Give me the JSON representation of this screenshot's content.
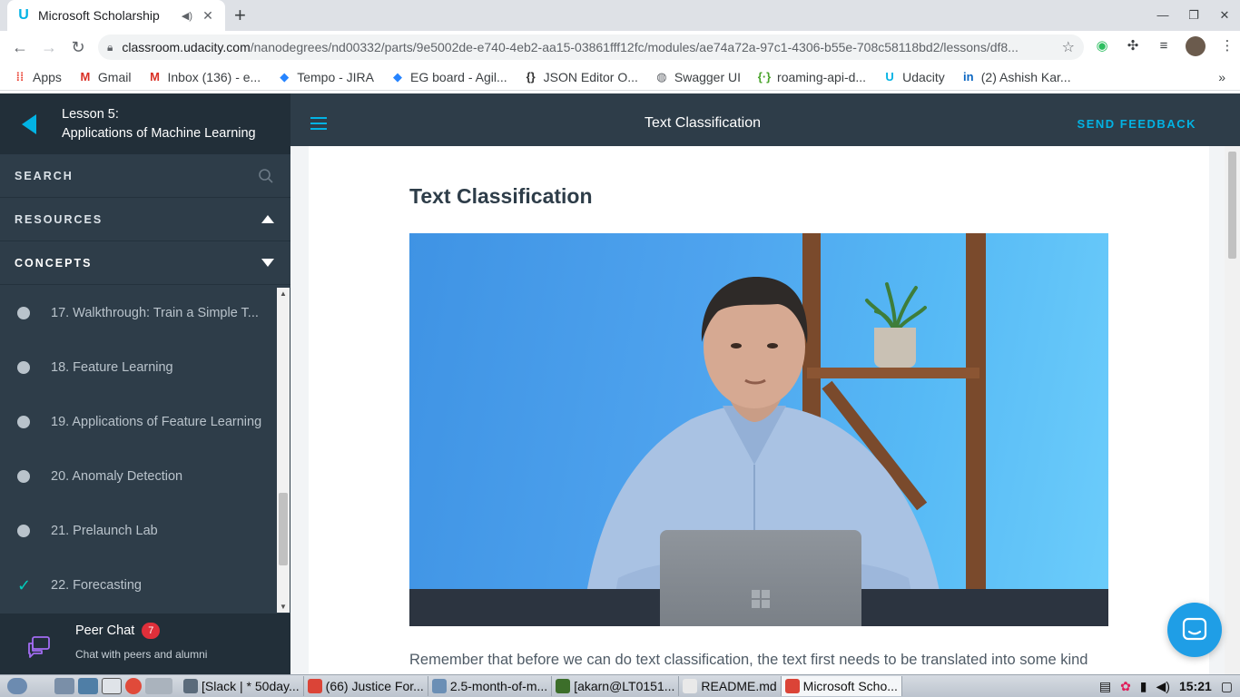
{
  "browser": {
    "tab": {
      "title": "Microsoft Scholarship",
      "favicon": "udacity-icon"
    },
    "url_host": "classroom.udacity.com",
    "url_path": "/nanodegrees/nd00332/parts/9e5002de-e740-4eb2-aa15-03861fff12fc/modules/ae74a72a-97c1-4306-b55e-708c58118bd2/lessons/df8...",
    "bookmarks": [
      {
        "label": "Apps",
        "icon": "apps-grid-icon",
        "color": "#ea4335"
      },
      {
        "label": "Gmail",
        "icon": "gmail-icon",
        "color": "#d93025"
      },
      {
        "label": "Inbox (136) - e...",
        "icon": "gmail-icon",
        "color": "#d93025"
      },
      {
        "label": "Tempo - JIRA",
        "icon": "jira-icon",
        "color": "#2684ff"
      },
      {
        "label": "EG board - Agil...",
        "icon": "jira-icon",
        "color": "#2684ff"
      },
      {
        "label": "JSON Editor O...",
        "icon": "json-icon",
        "color": "#333333"
      },
      {
        "label": "Swagger UI",
        "icon": "globe-icon",
        "color": "#5f6368"
      },
      {
        "label": "roaming-api-d...",
        "icon": "swagger-icon",
        "color": "#49a32b"
      },
      {
        "label": "Udacity",
        "icon": "udacity-icon",
        "color": "#02b3e4"
      },
      {
        "label": "(2) Ashish Kar...",
        "icon": "linkedin-icon",
        "color": "#0a66c2"
      }
    ]
  },
  "sidebar": {
    "lesson_number": "Lesson 5:",
    "lesson_title": "Applications of Machine Learning",
    "search_label": "SEARCH",
    "resources_label": "RESOURCES",
    "concepts_label": "CONCEPTS",
    "concepts": [
      {
        "label": "17. Walkthrough: Train a Simple T...",
        "done": false
      },
      {
        "label": "18. Feature Learning",
        "done": false
      },
      {
        "label": "19. Applications of Feature Learning",
        "done": false
      },
      {
        "label": "20. Anomaly Detection",
        "done": false
      },
      {
        "label": "21. Prelaunch Lab",
        "done": false
      },
      {
        "label": "22. Forecasting",
        "done": true
      }
    ],
    "peer_chat": {
      "title": "Peer Chat",
      "badge": "7",
      "subtitle": "Chat with peers and alumni"
    }
  },
  "header": {
    "title": "Text Classification",
    "feedback": "SEND FEEDBACK"
  },
  "content": {
    "title": "Text Classification",
    "body": "Remember that before we can do text classification, the text first needs to be translated into some kind"
  },
  "taskbar": {
    "items": [
      {
        "label": "[Slack | * 50day...",
        "color": "#5b6b7b"
      },
      {
        "label": "(66) Justice For...",
        "color": "#db4437"
      },
      {
        "label": "2.5-month-of-m...",
        "color": "#6b8fb5"
      },
      {
        "label": "[akarn@LT0151...",
        "color": "#3c6e2a"
      },
      {
        "label": "README.md",
        "color": "#e9e9e9"
      },
      {
        "label": "Microsoft Scho...",
        "color": "#db4437",
        "active": true
      }
    ],
    "clock": "15:21"
  },
  "colors": {
    "accent": "#02b3e4",
    "sidebar_bg": "#2e3d49",
    "complete": "#02ccba",
    "badge": "#e02f3a"
  }
}
